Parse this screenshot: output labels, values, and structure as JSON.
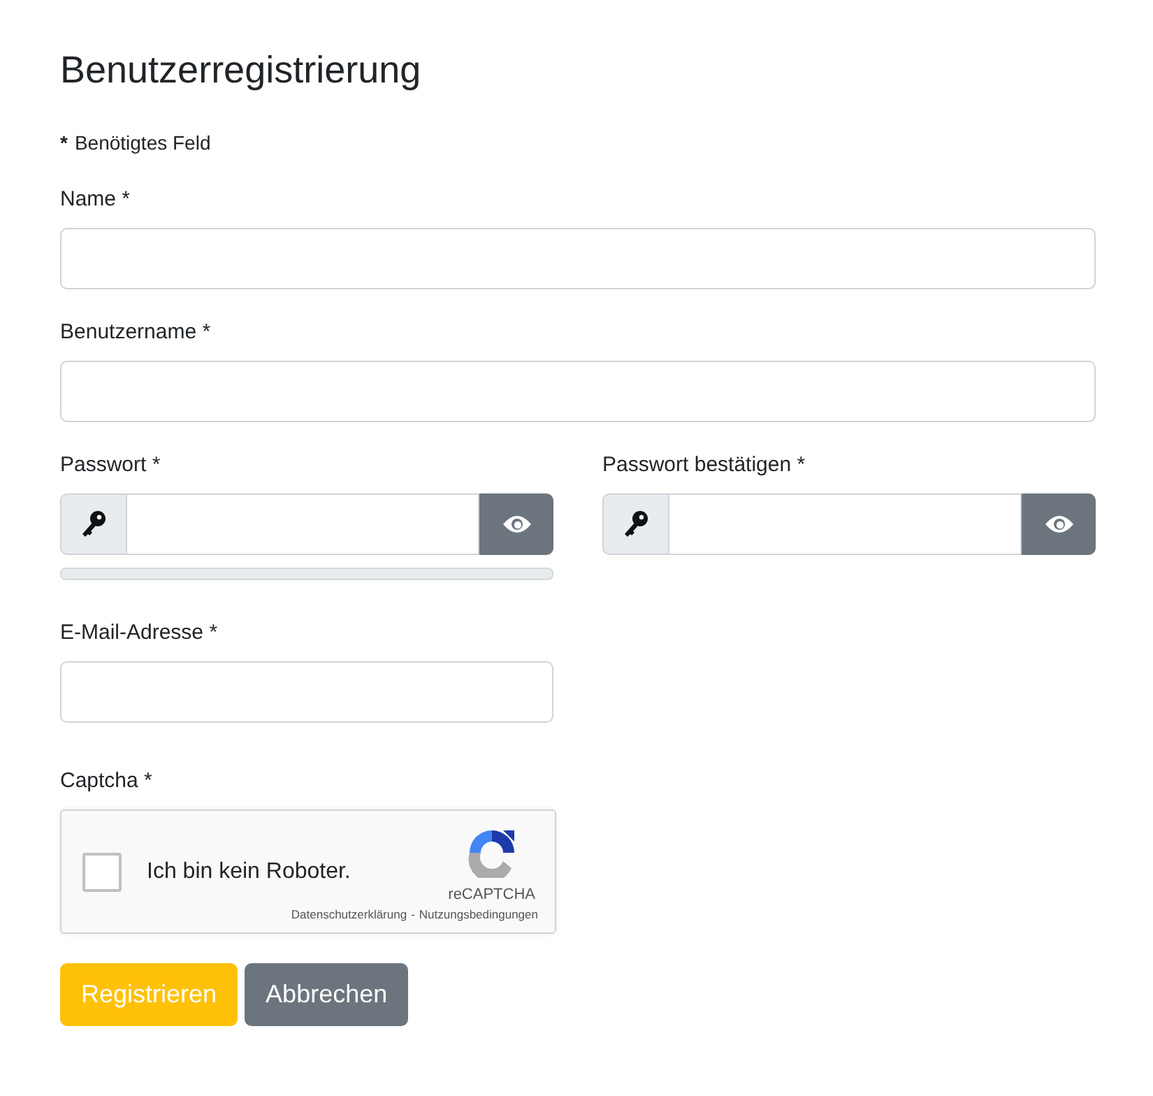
{
  "title": "Benutzerregistrierung",
  "required_note": {
    "mark": "*",
    "text": "Benötigtes Feld"
  },
  "fields": [
    {
      "kind": "text",
      "label": "Name *"
    },
    {
      "kind": "text",
      "label": "Benutzername *"
    }
  ],
  "password": {
    "label": "Passwort *"
  },
  "password_confirm": {
    "label": "Passwort bestätigen *"
  },
  "email": {
    "label": "E-Mail-Adresse *"
  },
  "captcha": {
    "label": "Captcha *",
    "checked": false,
    "text": "Ich bin kein Roboter.",
    "brand": "reCAPTCHA",
    "privacy_link": "Datenschutzerklärung",
    "separator": "-",
    "terms_link": "Nutzungsbedingungen"
  },
  "buttons": [
    {
      "kind": "primary",
      "label": "Registrieren"
    },
    {
      "kind": "secondary",
      "label": "Abbrechen"
    }
  ]
}
